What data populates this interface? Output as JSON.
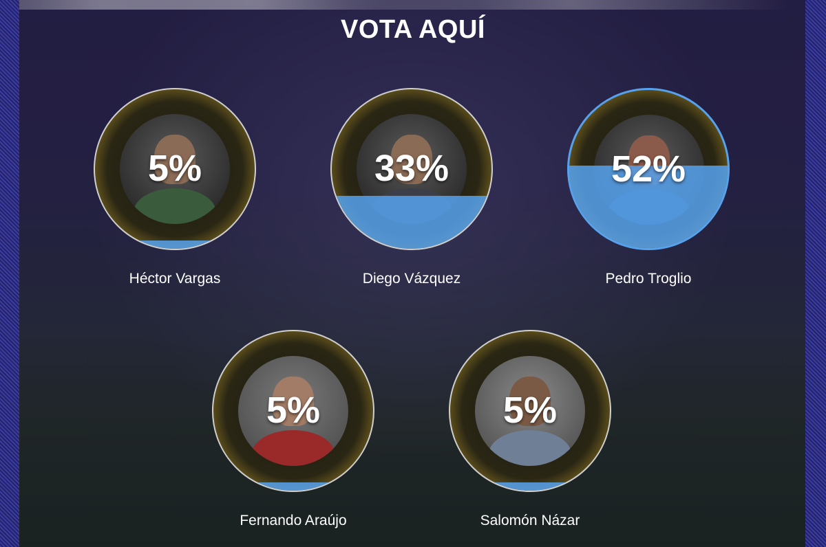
{
  "title": "VOTA AQUÍ",
  "candidates": [
    {
      "name": "Héctor Vargas",
      "percent_label": "5%",
      "percent": 5
    },
    {
      "name": "Diego Vázquez",
      "percent_label": "33%",
      "percent": 33
    },
    {
      "name": "Pedro Troglio",
      "percent_label": "52%",
      "percent": 52
    },
    {
      "name": "Fernando Araújo",
      "percent_label": "5%",
      "percent": 5
    },
    {
      "name": "Salomón Názar",
      "percent_label": "5%",
      "percent": 5
    }
  ],
  "colors": {
    "fill": "#56a2ee",
    "ring_gold": "#8a7322",
    "leader_border": "#56a2ee"
  }
}
